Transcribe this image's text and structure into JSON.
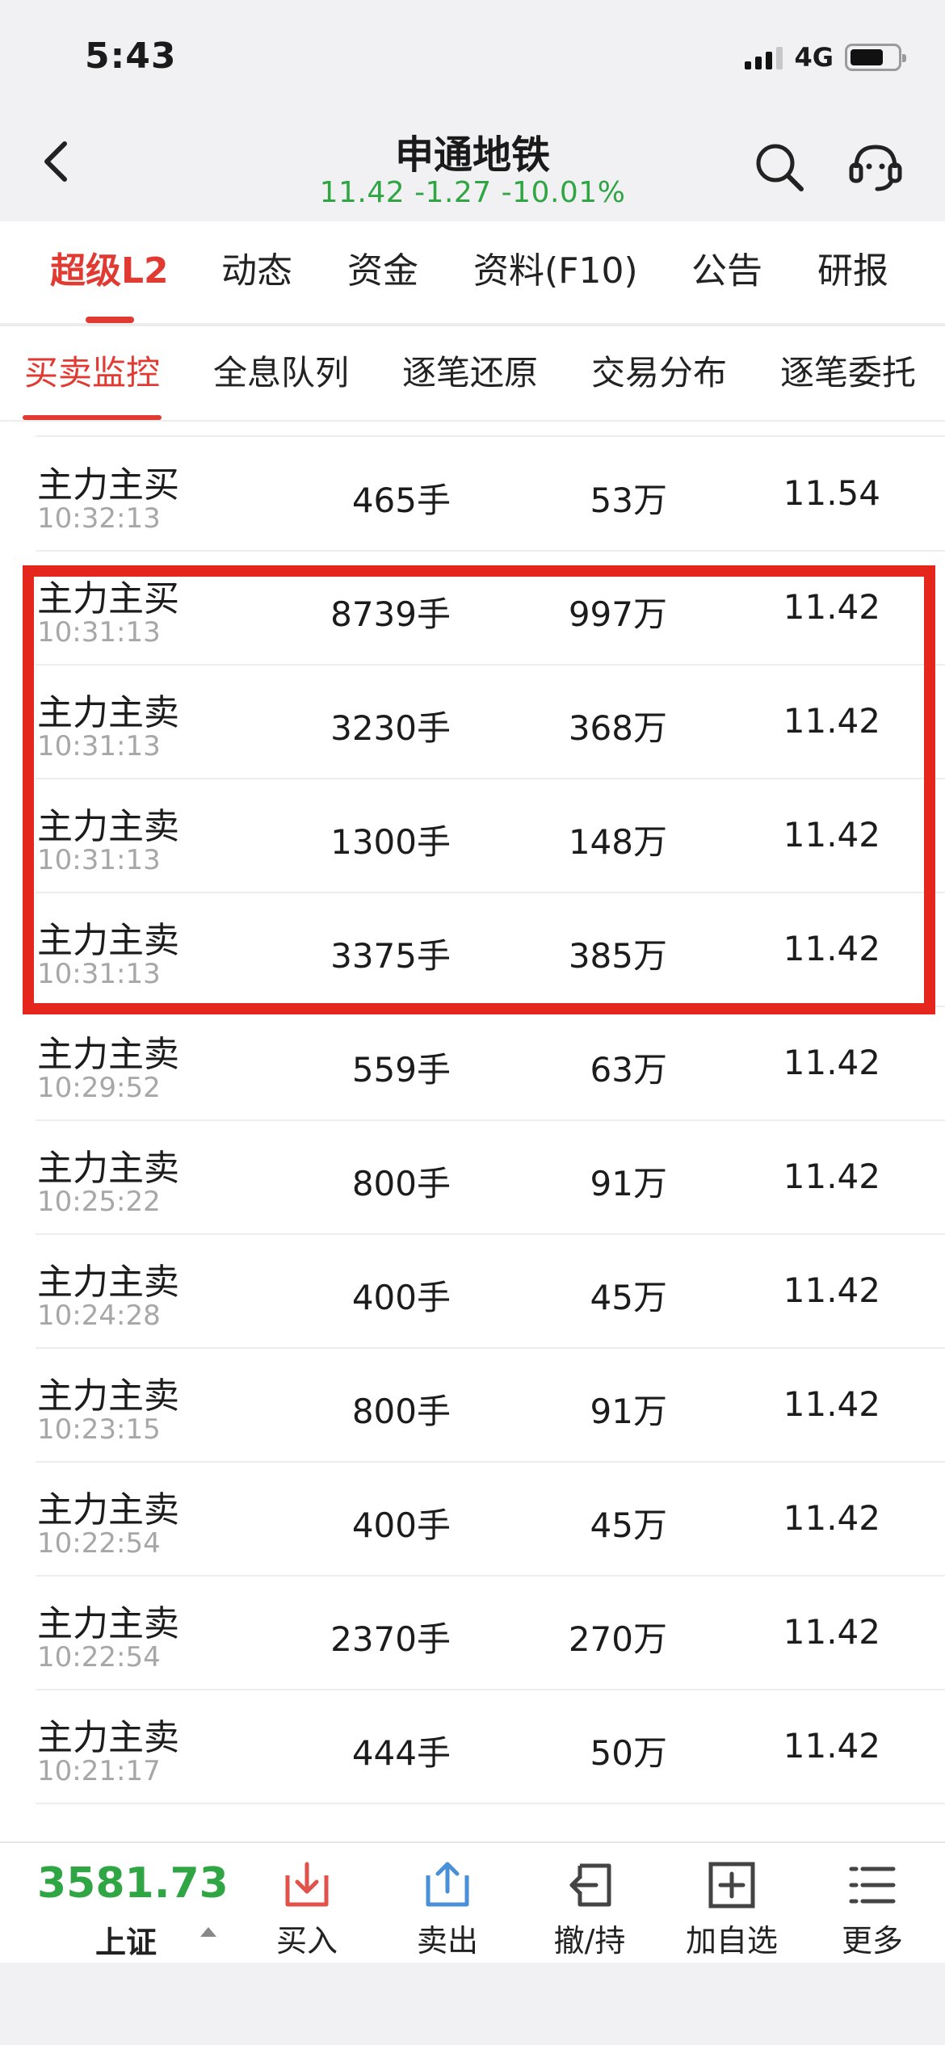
{
  "status_bar": {
    "time": "5:43",
    "network": "4G"
  },
  "header": {
    "title": "申通地铁",
    "subtitle": "11.42 -1.27 -10.01%",
    "subtitle_color": "#2fa543"
  },
  "primary_tabs": [
    "超级L2",
    "动态",
    "资金",
    "资料(F10)",
    "公告",
    "研报"
  ],
  "primary_tabs_active": "超级L2",
  "secondary_tabs": [
    "买卖监控",
    "全息队列",
    "逐笔还原",
    "交易分布",
    "逐笔委托"
  ],
  "secondary_tabs_active": "买卖监控",
  "rows": [
    {
      "type": "主力主买",
      "time": "10:32:13",
      "volume": "465手",
      "amount": "53万",
      "price": "11.54"
    },
    {
      "type": "主力主买",
      "time": "10:31:13",
      "volume": "8739手",
      "amount": "997万",
      "price": "11.42"
    },
    {
      "type": "主力主卖",
      "time": "10:31:13",
      "volume": "3230手",
      "amount": "368万",
      "price": "11.42"
    },
    {
      "type": "主力主卖",
      "time": "10:31:13",
      "volume": "1300手",
      "amount": "148万",
      "price": "11.42"
    },
    {
      "type": "主力主卖",
      "time": "10:31:13",
      "volume": "3375手",
      "amount": "385万",
      "price": "11.42"
    },
    {
      "type": "主力主卖",
      "time": "10:29:52",
      "volume": "559手",
      "amount": "63万",
      "price": "11.42"
    },
    {
      "type": "主力主卖",
      "time": "10:25:22",
      "volume": "800手",
      "amount": "91万",
      "price": "11.42"
    },
    {
      "type": "主力主卖",
      "time": "10:24:28",
      "volume": "400手",
      "amount": "45万",
      "price": "11.42"
    },
    {
      "type": "主力主卖",
      "time": "10:23:15",
      "volume": "800手",
      "amount": "91万",
      "price": "11.42"
    },
    {
      "type": "主力主卖",
      "time": "10:22:54",
      "volume": "400手",
      "amount": "45万",
      "price": "11.42"
    },
    {
      "type": "主力主卖",
      "time": "10:22:54",
      "volume": "2370手",
      "amount": "270万",
      "price": "11.42"
    },
    {
      "type": "主力主卖",
      "time": "10:21:17",
      "volume": "444手",
      "amount": "50万",
      "price": "11.42"
    }
  ],
  "toolbar": {
    "index_value": "3581.73",
    "index_name": "上证",
    "buy_label": "买入",
    "sell_label": "卖出",
    "cancel_label": "撤/持",
    "add_watch_label": "加自选",
    "more_label": "更多"
  },
  "colors": {
    "accent_red": "#e03a33",
    "highlight_red": "#e4261c",
    "down_green": "#2fa543",
    "buy_icon": "#e0524a",
    "sell_icon": "#4a90d9"
  }
}
